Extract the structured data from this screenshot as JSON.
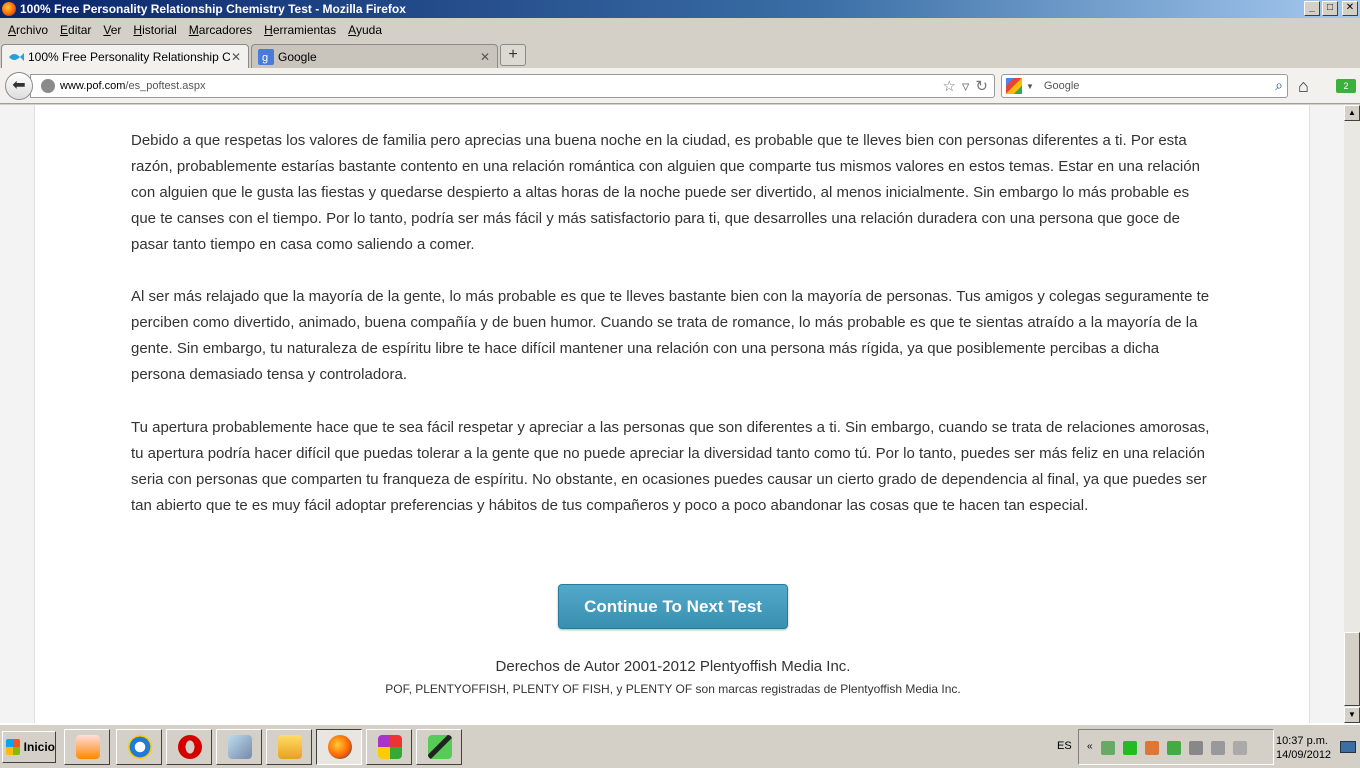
{
  "window": {
    "title": "100% Free Personality Relationship Chemistry Test - Mozilla Firefox",
    "controls": [
      "_",
      "□",
      "✕"
    ]
  },
  "menu": [
    {
      "u": "A",
      "rest": "rchivo"
    },
    {
      "u": "E",
      "rest": "ditar"
    },
    {
      "u": "V",
      "rest": "er"
    },
    {
      "u": "H",
      "rest": "istorial"
    },
    {
      "u": "M",
      "rest": "arcadores"
    },
    {
      "u": "H",
      "rest": "erramientas"
    },
    {
      "u": "A",
      "rest": "yuda"
    }
  ],
  "tabs": {
    "active_label": "100% Free Personality Relationship Che...",
    "inactive_label": "Google",
    "close": "✕",
    "new_tab": "+"
  },
  "nav": {
    "url_host": "www.pof.com",
    "url_path": "/es_poftest.aspx",
    "search_placeholder": "Google"
  },
  "content": {
    "paragraph1": "Debido a que respetas los valores de familia pero aprecias una buena noche en la ciudad, es probable que te lleves bien con personas diferentes a ti. Por esta razón, probablemente estarías bastante contento en una relación romántica con alguien que comparte tus mismos valores en estos temas. Estar en una relación con alguien que le gusta las fiestas y quedarse despierto a altas horas de la noche puede ser divertido, al menos inicialmente. Sin embargo lo más probable es que te canses con el tiempo. Por lo tanto, podría ser más fácil y más satisfactorio para ti, que desarrolles una relación duradera con una persona que goce de pasar tanto tiempo en casa como saliendo a comer.",
    "paragraph2": "Al ser más relajado que la mayoría de la gente, lo más probable es que te lleves bastante bien con la mayoría de personas. Tus amigos y colegas seguramente te perciben como divertido, animado, buena compañía y de buen humor. Cuando se trata de romance, lo más probable es que te sientas atraído a la mayoría de la gente. Sin embargo, tu naturaleza de espíritu libre te hace difícil mantener una relación con una persona más rígida, ya que posiblemente percibas a dicha persona demasiado tensa y controladora.",
    "paragraph3": "Tu apertura probablemente hace que te sea fácil respetar y apreciar a las personas que son diferentes a ti. Sin embargo, cuando se trata de relaciones amorosas, tu apertura podría hacer difícil que puedas tolerar a la gente que no puede apreciar la diversidad tanto como tú. Por lo tanto, puedes ser más feliz en una relación seria con personas que comparten tu franqueza de espíritu. No obstante, en ocasiones puedes causar un cierto grado de dependencia al final, ya que puedes ser tan abierto que te es muy fácil adoptar preferencias y hábitos de tus compañeros y poco a poco abandonar las cosas que te hacen tan especial.",
    "continue_button": "Continue To Next Test",
    "copyright": "Derechos de Autor 2001-2012 Plentyoffish Media Inc.",
    "trademark": "POF, PLENTYOFFISH, PLENTY OF FISH, y PLENTY OF son marcas registradas de Plentyoffish Media Inc."
  },
  "taskbar": {
    "start_label": "Inicio",
    "language": "ES",
    "time": "10:37 p.m.",
    "date": "14/09/2012",
    "tray_chevron": "«"
  }
}
